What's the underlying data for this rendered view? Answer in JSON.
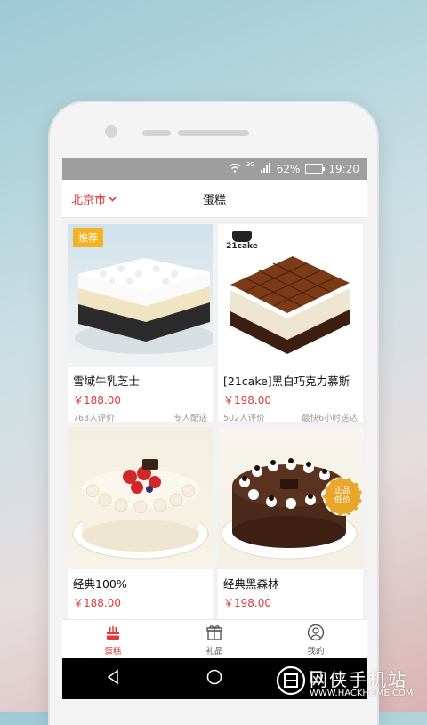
{
  "status": {
    "signal": "3G",
    "battery": "62%",
    "time": "19:20"
  },
  "header": {
    "city": "北京市",
    "title": "蛋糕"
  },
  "products": [
    {
      "name": "雪域牛乳芝士",
      "price": "￥188.00",
      "reviews": "763人评价",
      "delivery": "专人配送",
      "badge": "推荐"
    },
    {
      "name": "[21cake]黑白巧克力慕斯",
      "price": "￥198.00",
      "reviews": "502人评价",
      "delivery": "最快6小时送达",
      "brand_logo": "21cake"
    },
    {
      "name": "经典100%",
      "price": "￥188.00",
      "reviews": "",
      "delivery": ""
    },
    {
      "name": "经典黑森林",
      "price": "￥198.00",
      "reviews": "",
      "delivery": "",
      "seal": "正品低价"
    }
  ],
  "tabs": [
    {
      "label": "蛋糕",
      "icon": "cake-icon",
      "active": true
    },
    {
      "label": "礼品",
      "icon": "gift-icon",
      "active": false
    },
    {
      "label": "我的",
      "icon": "user-icon",
      "active": false
    }
  ],
  "watermark": {
    "title": "网侠手机站",
    "url": "WWW.HACKHOME.COM"
  },
  "colors": {
    "accent": "#e03a3a",
    "badge": "#f5b324",
    "statusbar": "#9e9e9e"
  }
}
